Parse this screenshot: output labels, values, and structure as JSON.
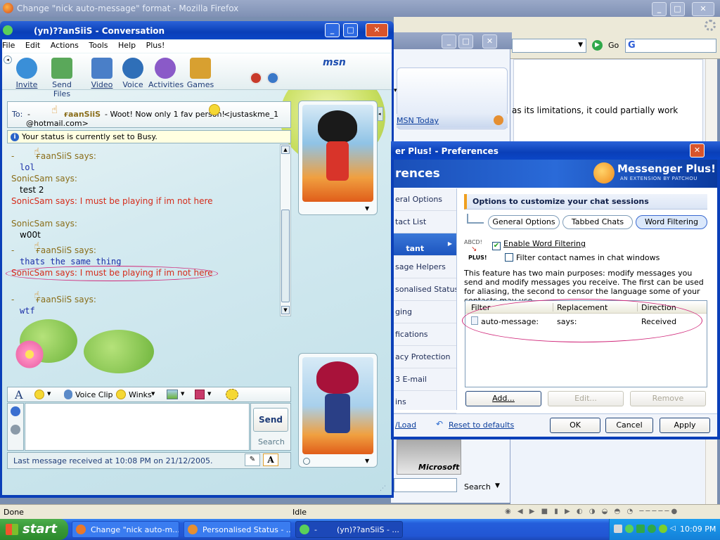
{
  "firefox": {
    "title": "Change \"nick auto-message\" format - Mozilla Firefox",
    "go_label": "Go",
    "article_text": "as its limitations, it could partially work",
    "status_text": "Done",
    "idle_text": "Idle"
  },
  "personalised_window": {
    "msn_today": "MSN Today",
    "search_label": "Search",
    "microsoft_label": "Microsoft"
  },
  "conversation": {
    "title": "(yn)??anSiiS - Conversation",
    "menu": [
      "File",
      "Edit",
      "Actions",
      "Tools",
      "Help",
      "Plus!"
    ],
    "msn_logo": "msn",
    "toolbar": [
      {
        "label": "Invite",
        "icon": "invite-icon",
        "color": "#3a8fd8"
      },
      {
        "label": "Send Files",
        "icon": "send-files-icon",
        "color": "#5aa85a"
      },
      {
        "label": "Video",
        "icon": "video-icon",
        "color": "#4a7fc8"
      },
      {
        "label": "Voice",
        "icon": "voice-icon",
        "color": "#2f6fb8"
      },
      {
        "label": "Activities",
        "icon": "activities-icon",
        "color": "#8a5ac8"
      },
      {
        "label": "Games",
        "icon": "games-icon",
        "color": "#d8a030"
      }
    ],
    "to_prefix": "To:",
    "to_dash": "-",
    "to_name": "ғaanSiiS",
    "to_message": "- Woot! Now only 1 fav person!",
    "to_email_a": "<justaskme_1",
    "to_email_b": "@hotmail.com>",
    "status_notice": "Your status is currently set to Busy.",
    "messages": [
      {
        "text": "-        ғaanSiiS says:",
        "style": "says"
      },
      {
        "text": "lol",
        "style": "mono"
      },
      {
        "text": "SonicSam says:",
        "style": "says"
      },
      {
        "text": "test 2",
        "style": "plain"
      },
      {
        "text": "SonicSam says: I must be playing if im not here",
        "style": "red"
      },
      {
        "text": "SonicSam says:",
        "style": "says"
      },
      {
        "text": "w00t",
        "style": "plain"
      },
      {
        "text": "-        ғaanSiiS says:",
        "style": "says"
      },
      {
        "text": "thats the same thing",
        "style": "mono"
      },
      {
        "text": "SonicSam says: I must be playing if im not here",
        "style": "red"
      },
      {
        "text": "-        ғaanSiiS says:",
        "style": "says"
      },
      {
        "text": "wtf",
        "style": "mono"
      }
    ],
    "compose_toolbar": {
      "font_label": "A",
      "voice_clip": "Voice Clip",
      "winks": "Winks"
    },
    "send_label": "Send",
    "search_label": "Search",
    "last_message": "Last message received at 10:08 PM on 21/12/2005."
  },
  "prefs": {
    "title": "er Plus! - Preferences",
    "header": "rences",
    "brand_title": "Messenger Plus!",
    "brand_sub": "AN EXTENSION BY PATCHOU",
    "nav": [
      "eral Options",
      "tact List",
      "tant\nessages",
      "sage Helpers",
      "sonalised Status",
      "ging",
      "fications",
      "acy Protection",
      "3 E-mail",
      "ins"
    ],
    "section_title": "Options to customize your chat sessions",
    "tabs": [
      "General Options",
      "Tabbed Chats",
      "Word Filtering"
    ],
    "abcd_label": "ABCD!",
    "plus_badge": "PLUS!",
    "enable_label": "Enable Word Filtering",
    "filter_names_label": "Filter contact names in chat windows",
    "description": "This feature has two main purposes: modify messages you send and modify messages you receive. The first can be used for aliasing, the second to censor the language some of your contacts may use.",
    "table": {
      "headers": [
        "Filter",
        "Replacement",
        "Direction"
      ],
      "rows": [
        [
          "auto-message:",
          "says:",
          "Received"
        ]
      ]
    },
    "add_label": "Add...",
    "edit_label": "Edit...",
    "remove_label": "Remove",
    "load_label": "/Load",
    "reset_label": "Reset to defaults",
    "ok_label": "OK",
    "cancel_label": "Cancel",
    "apply_label": "Apply"
  },
  "taskbar": {
    "start_label": "start",
    "buttons": [
      "Change \"nick auto-m...",
      "Personalised Status - ...",
      "-        (yn)??anSiiS - ..."
    ],
    "clock": "10:09 PM"
  },
  "colors": {
    "xp_blue": "#245edb",
    "highlight_ellipse": "#d0287a",
    "status_red": "#d52b1a"
  }
}
